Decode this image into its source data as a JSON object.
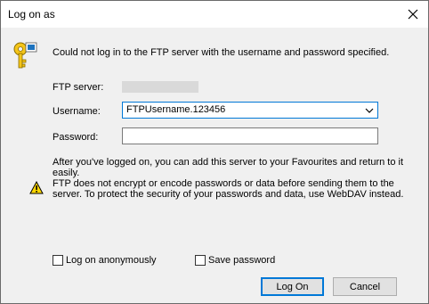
{
  "window": {
    "title": "Log on as"
  },
  "dialog": {
    "message": "Could not log in to the FTP server with the username and password specified.",
    "server_label": "FTP server:",
    "username_label": "Username:",
    "username_value": "FTPUsername.123456",
    "password_label": "Password:",
    "password_value": "",
    "info_favourites": "After you've logged on, you can add this server to your Favourites and return to it easily.",
    "warning_text": "FTP does not encrypt or encode passwords or data before sending them to the server. To protect the security of your passwords and data, use WebDAV instead.",
    "anonymous_label": "Log on anonymously",
    "anonymous_checked": false,
    "save_password_label": "Save password",
    "save_password_checked": false
  },
  "buttons": {
    "logon": "Log On",
    "cancel": "Cancel"
  },
  "icons": {
    "close": "close-icon",
    "key": "key-icon",
    "warning": "warning-icon",
    "dropdown": "chevron-down-icon"
  },
  "colors": {
    "accent": "#0078d7",
    "dialog_bg": "#f0f0f0",
    "button_bg": "#e1e1e1",
    "redacted": "#d9d9d9"
  }
}
